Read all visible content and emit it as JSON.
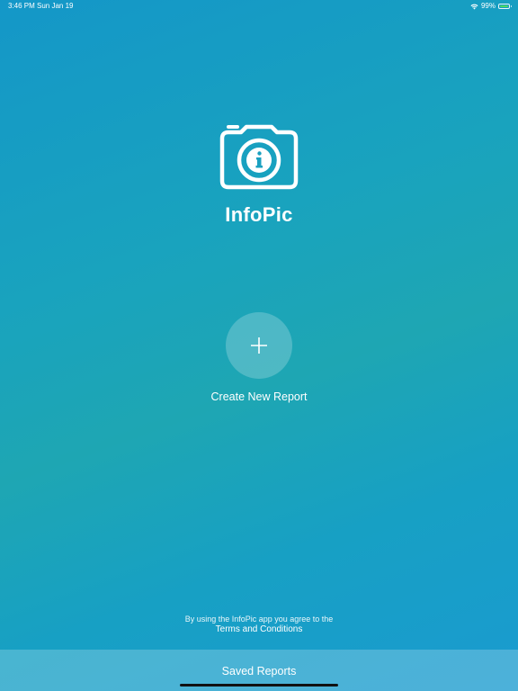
{
  "status_bar": {
    "time": "3:46 PM   Sun Jan 19",
    "battery_percent": "99%",
    "battery_level": 0.99,
    "wifi_icon": "wifi-icon",
    "battery_icon": "battery-icon"
  },
  "app": {
    "name": "InfoPic",
    "logo_icon": "camera-info-icon"
  },
  "create": {
    "icon": "plus-icon",
    "label": "Create New Report"
  },
  "footer": {
    "agree_text": "By using the InfoPic app you agree to the",
    "terms_link": "Terms and Conditions"
  },
  "saved_reports": {
    "label": "Saved Reports"
  },
  "colors": {
    "background_top": "#1497c8",
    "background_mid": "#1ea6b3",
    "background_bottom": "#1a9bd0",
    "text": "#ffffff",
    "battery_fill": "#4cd964"
  }
}
